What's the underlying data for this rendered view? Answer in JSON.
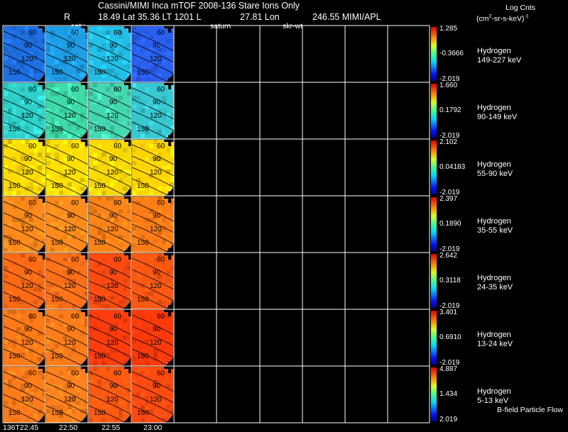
{
  "header": {
    "title": "Cassini/MIMI Inca mTOF  2008-136   Stare   Ions Only",
    "r_label": "R",
    "position": "18.49 Lat 35.36 LT 1201 L",
    "lon": "27.81 Lon",
    "credit": "246.55  MIMI/APL",
    "satur_label": "satur",
    "saturn_label": "saturn",
    "skr_label": "skr-wt",
    "units_title": "Log Cnts",
    "units_pre": "(cm",
    "units_sup": "2",
    "units_post": "-sr-s-keV)",
    "units_sup2": "-1",
    "bfield_label": "B-field Particle Flow"
  },
  "chart_data": {
    "type": "heatmap",
    "time_labels": [
      "136T22:45",
      "22:50",
      "22:55",
      "23:00"
    ],
    "contour_labels": [
      "60",
      "90",
      "120",
      "150"
    ],
    "energy_bands": [
      {
        "species": "Hydrogen",
        "range": "149-227 keV",
        "max": "1.285",
        "mid": "-0.3666",
        "min": "-2.019"
      },
      {
        "species": "Hydrogen",
        "range": "90-149 keV",
        "max": "1.660",
        "mid": "0.1792",
        "min": "-2.019"
      },
      {
        "species": "Hydrogen",
        "range": "55-90 keV",
        "max": "2.102",
        "mid": "0.04183",
        "min": "-2.019"
      },
      {
        "species": "Hydrogen",
        "range": "35-55 keV",
        "max": "2.397",
        "mid": "0.1890",
        "min": "-2.019"
      },
      {
        "species": "Hydrogen",
        "range": "24-35 keV",
        "max": "2.642",
        "mid": "0.3118",
        "min": "-2.019"
      },
      {
        "species": "Hydrogen",
        "range": "13-24 keV",
        "max": "3.401",
        "mid": "0.6910",
        "min": "-2.019"
      },
      {
        "species": "Hydrogen",
        "range": "5-13 keV",
        "max": "4.887",
        "mid": "1.434",
        "min": "2.019"
      }
    ],
    "images_per_band": 4,
    "band_colors": [
      [
        "#1e6fe0",
        "#1f9ee8",
        "#22c0e8",
        "#2a5ff0"
      ],
      [
        "#2fd0c8",
        "#3edaa8",
        "#44d8b0",
        "#38c8d0"
      ],
      [
        "#ffdc00",
        "#ffe000",
        "#f8d800",
        "#ffd400"
      ],
      [
        "#ff8a1a",
        "#ff8c1c",
        "#ff8418",
        "#ff7c16"
      ],
      [
        "#ff6a14",
        "#ff7018",
        "#ff4a10",
        "#ff5812"
      ],
      [
        "#ff7a18",
        "#ff7c1a",
        "#ff3c0c",
        "#ff3a0a"
      ],
      [
        "#ff7c1a",
        "#ff801c",
        "#ff5a12",
        "#ff4a10"
      ]
    ]
  }
}
